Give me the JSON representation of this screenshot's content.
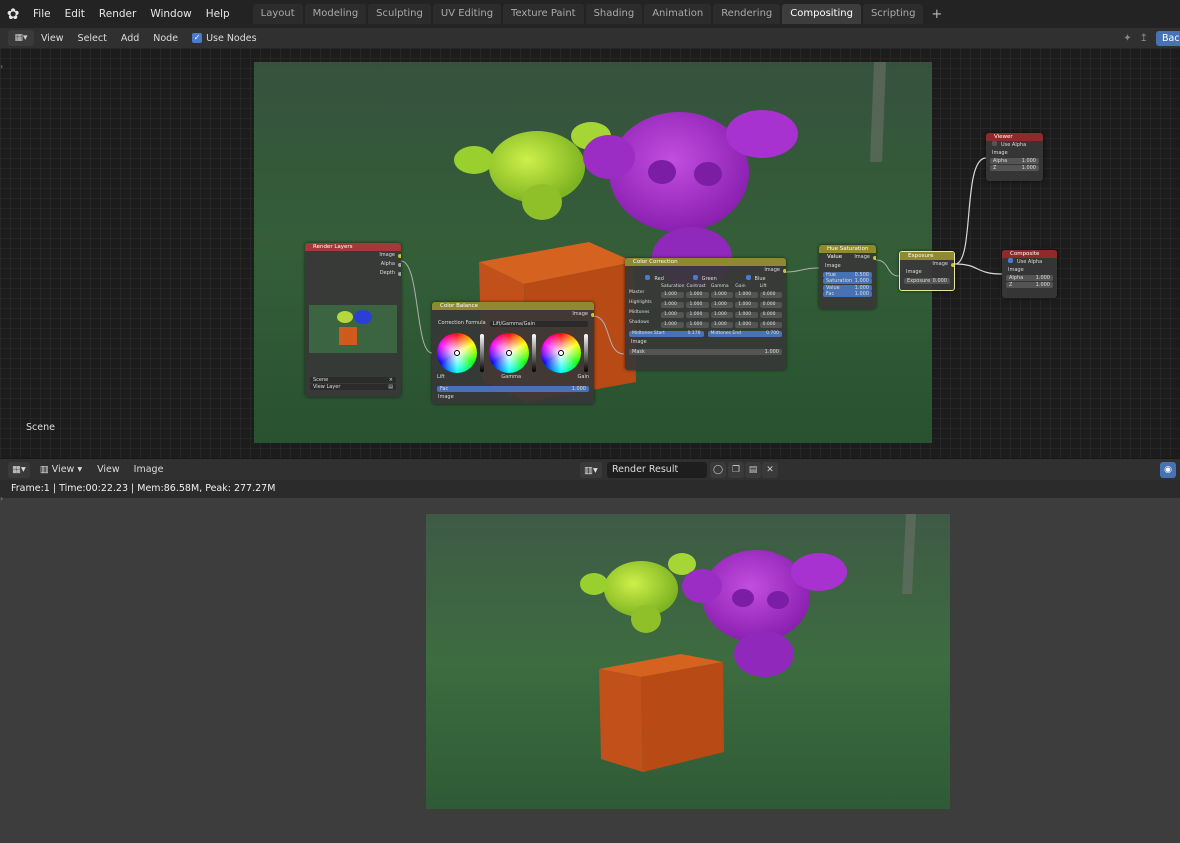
{
  "topbar": {
    "menus": [
      "File",
      "Edit",
      "Render",
      "Window",
      "Help"
    ],
    "tabs": [
      "Layout",
      "Modeling",
      "Sculpting",
      "UV Editing",
      "Texture Paint",
      "Shading",
      "Animation",
      "Rendering",
      "Compositing",
      "Scripting"
    ],
    "active_tab": "Compositing",
    "add_tab": "+"
  },
  "node_header": {
    "view": "View",
    "select": "Select",
    "add": "Add",
    "node": "Node",
    "use_nodes": "Use Nodes",
    "back_button": "Bac"
  },
  "node_editor": {
    "scene_label": "Scene",
    "nodes": {
      "render_layers": {
        "title": "Render Layers",
        "outputs": [
          "Image",
          "Alpha",
          "Depth"
        ],
        "scene": "Scene",
        "view_layer": "View Layer"
      },
      "color_balance": {
        "title": "Color Balance",
        "correction_formula_label": "Correction Formula",
        "correction_formula": "Lift/Gamma/Gain",
        "output": "Image",
        "wheels": [
          "Lift",
          "Gamma",
          "Gain"
        ],
        "fac_label": "Fac",
        "fac": "1.000",
        "input": "Image"
      },
      "color_correction": {
        "title": "Color Correction",
        "output": "Image",
        "channels": [
          "Red",
          "Green",
          "Blue"
        ],
        "columns": [
          "Saturation",
          "Contrast",
          "Gamma",
          "Gain",
          "Lift"
        ],
        "rows": [
          {
            "label": "Master",
            "values": [
              "1.000",
              "1.000",
              "1.000",
              "1.000",
              "0.000"
            ]
          },
          {
            "label": "Highlights",
            "values": [
              "1.000",
              "1.000",
              "1.000",
              "1.000",
              "0.000"
            ]
          },
          {
            "label": "Midtones",
            "values": [
              "1.000",
              "1.000",
              "1.000",
              "1.000",
              "0.000"
            ]
          },
          {
            "label": "Shadows",
            "values": [
              "1.000",
              "1.000",
              "1.000",
              "1.000",
              "0.000"
            ]
          }
        ],
        "midtones_start_label": "Midtones Start",
        "midtones_start": "0.176",
        "midtones_end_label": "Midtones End",
        "midtones_end": "0.700",
        "input_image": "Image",
        "mask_label": "Mask",
        "mask": "1.000"
      },
      "hue_sat": {
        "title": "Hue Saturation Value",
        "output": "Image",
        "input": "Image",
        "fields": [
          {
            "label": "Hue",
            "value": "0.500"
          },
          {
            "label": "Saturation",
            "value": "1.000"
          },
          {
            "label": "Value",
            "value": "1.000"
          },
          {
            "label": "Fac",
            "value": "1.000"
          }
        ]
      },
      "exposure": {
        "title": "Exposure",
        "output": "Image",
        "input": "Image",
        "exposure_label": "Exposure",
        "exposure": "0.000"
      },
      "viewer": {
        "title": "Viewer",
        "use_alpha": "Use Alpha",
        "input": "Image",
        "alpha_label": "Alpha",
        "alpha": "1.000",
        "z_label": "Z",
        "z": "1.000"
      },
      "composite": {
        "title": "Composite",
        "use_alpha": "Use Alpha",
        "input": "Image",
        "alpha_label": "Alpha",
        "alpha": "1.000",
        "z_label": "Z",
        "z": "1.000"
      }
    }
  },
  "image_header": {
    "view_menu": "View",
    "view": "View",
    "image": "Image",
    "image_name": "Render Result"
  },
  "status": {
    "text": "Frame:1 | Time:00:22.23 | Mem:86.58M, Peak: 277.27M"
  },
  "colors": {
    "accent": "#4772b3",
    "render_layers_header": "#a33a3a",
    "color_node_header": "#8f8a2e",
    "output_node_header": "#8f2a2a",
    "socket_color": "#c7c729"
  }
}
